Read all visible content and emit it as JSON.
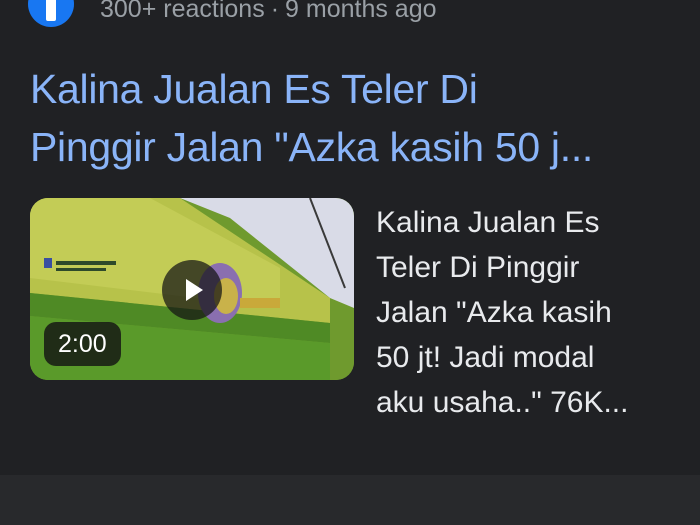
{
  "result": {
    "source_icon": "facebook-icon",
    "reactions": "300+ reactions",
    "separator": "·",
    "age": "9 months ago",
    "title_line1": "Kalina Jualan Es Teler Di",
    "title_line2": "Pinggir Jalan \"Azka kasih 50 j...",
    "video": {
      "duration": "2:00",
      "play_icon": "play-icon"
    },
    "snippet_lines": [
      "Kalina Jualan Es",
      "Teler Di Pinggir",
      "Jalan \"Azka kasih",
      "50 jt! Jadi modal",
      "aku usaha..\" 76K..."
    ]
  },
  "colors": {
    "background": "#202124",
    "title": "#8ab4f8",
    "meta": "#9aa0a6",
    "snippet": "#e8eaed",
    "facebook": "#1877f2"
  }
}
